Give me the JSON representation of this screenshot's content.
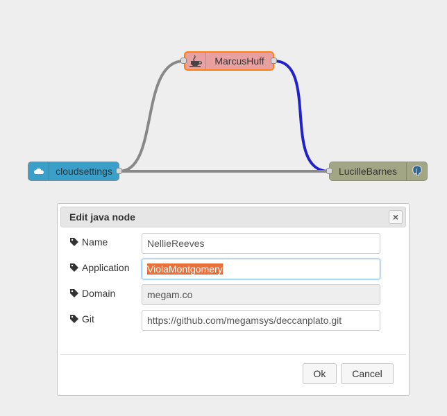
{
  "nodes": {
    "cloud": {
      "label": "cloudsettings",
      "icon": "cloud-icon",
      "color": "#3a9fc9"
    },
    "marcus": {
      "label": "MarcusHuff",
      "icon": "java-cup-icon",
      "color": "#e9a0a0"
    },
    "lucille": {
      "label": "LucilleBarnes",
      "icon": "postgresql-icon",
      "color": "#a3a684"
    }
  },
  "wires": [
    {
      "from": "cloudsettings",
      "to": "MarcusHuff",
      "color": "#888888"
    },
    {
      "from": "MarcusHuff",
      "to": "LucilleBarnes",
      "color": "#2222cc"
    },
    {
      "from": "cloudsettings",
      "to": "LucilleBarnes",
      "color": "#888888"
    }
  ],
  "dialog": {
    "title": "Edit java node",
    "close_icon": "close-icon",
    "fields": {
      "name": {
        "label": "Name",
        "value": "NellieReeves",
        "icon": "tag-icon"
      },
      "application": {
        "label": "Application",
        "value": "ViolaMontgomery",
        "icon": "tag-icon"
      },
      "domain": {
        "label": "Domain",
        "value": "megam.co",
        "icon": "tag-icon"
      },
      "git": {
        "label": "Git",
        "value": "https://github.com/megamsys/deccanplato.git",
        "icon": "tag-icon"
      }
    },
    "ok_label": "Ok",
    "cancel_label": "Cancel"
  }
}
